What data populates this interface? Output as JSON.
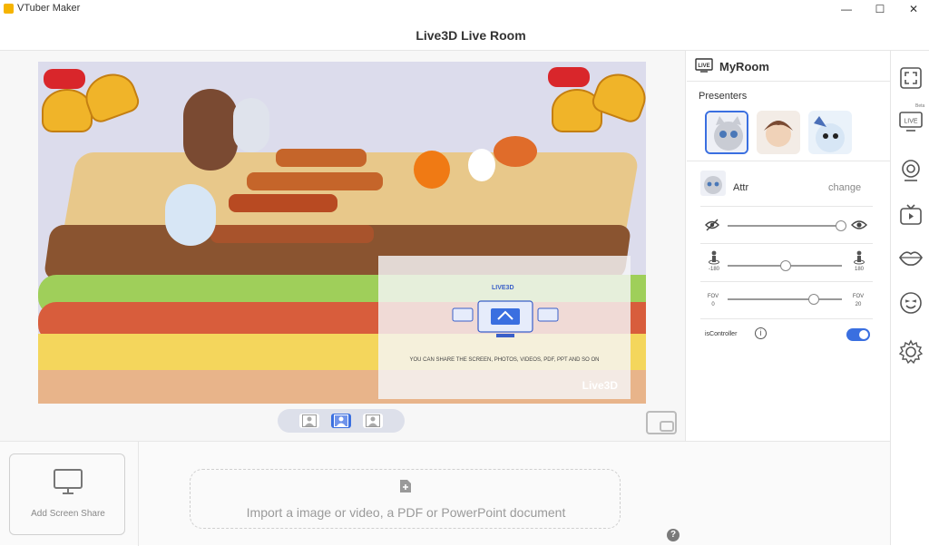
{
  "window": {
    "app_title": "VTuber Maker",
    "minimize": "—",
    "maximize": "☐",
    "close": "✕"
  },
  "header": {
    "title": "Live3D Live Room"
  },
  "stage": {
    "share_hint": "YOU CAN SHARE THE SCREEN, PHOTOS, VIDEOS, PDF, PPT AND SO ON",
    "share_logo": "LIVE3D",
    "powered_by": "Live3D",
    "pager_selected_index": 1
  },
  "bottom": {
    "screen_share_label": "Add  Screen Share",
    "import_text": "Import a image or video,  a PDF or PowerPoint document",
    "help": "?"
  },
  "panel": {
    "room_title": "MyRoom",
    "room_icon_text": "LIVE",
    "presenters_label": "Presenters",
    "presenters": [
      {
        "name": "cat",
        "selected": true
      },
      {
        "name": "boy",
        "selected": false
      },
      {
        "name": "creature",
        "selected": false
      }
    ],
    "attr_label": "Attr",
    "change_label": "change",
    "visibility_slider_value": 1.0,
    "rotation": {
      "min_label": "-180",
      "max_label": "180",
      "value": 0
    },
    "fov": {
      "left_label": "FOV",
      "left_value": "0",
      "right_label": "FOV",
      "right_value": "20",
      "value": 0.7
    },
    "controller_label": "isController",
    "controller_on": true
  },
  "sidebar": {
    "items": [
      {
        "name": "fullscreen"
      },
      {
        "name": "live",
        "text": "LIVE",
        "badge": "Beta"
      },
      {
        "name": "webcam"
      },
      {
        "name": "video"
      },
      {
        "name": "lips"
      },
      {
        "name": "face"
      },
      {
        "name": "settings"
      }
    ]
  },
  "colors": {
    "accent": "#3a6fe0",
    "divider": "#e6e6e6"
  }
}
